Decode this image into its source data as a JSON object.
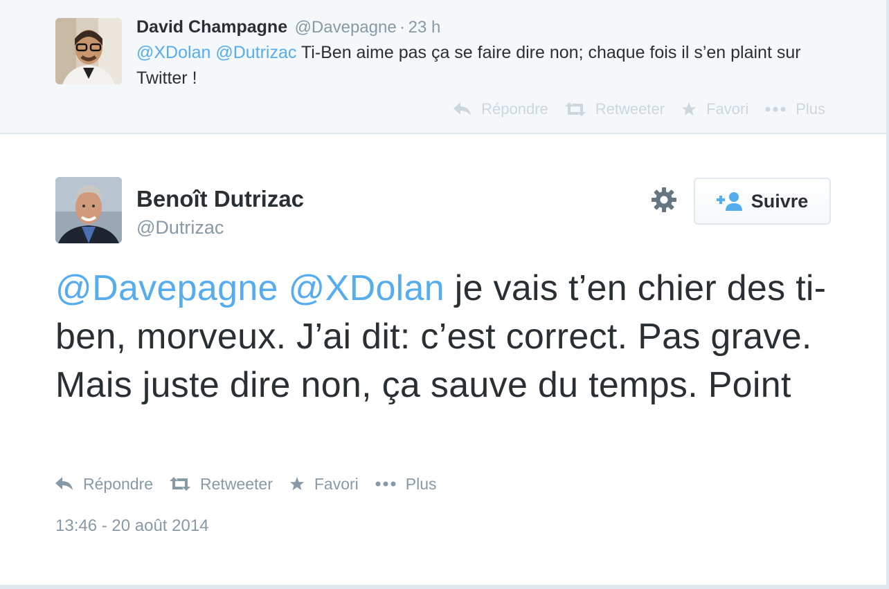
{
  "colors": {
    "accent": "#55acee",
    "text": "#292f33",
    "muted": "#8899a6",
    "faded": "#ccd6dd",
    "context_bg": "#f5f8fa"
  },
  "parent_tweet": {
    "avatar_icon": "user-photo-avatar",
    "name": "David Champagne",
    "handle": "@Davepagne",
    "separator": "·",
    "time": "23 h",
    "mention_1": "@XDolan",
    "mention_2": "@Dutrizac",
    "text": "Ti-Ben aime pas ça se faire dire non; chaque fois il s’en plaint sur Twitter !",
    "actions": {
      "reply": "Répondre",
      "retweet": "Retweeter",
      "favorite": "Favori",
      "more": "Plus"
    }
  },
  "main_tweet": {
    "avatar_icon": "user-photo-avatar",
    "name": "Benoît Dutrizac",
    "handle": "@Dutrizac",
    "settings_icon": "gear-icon",
    "follow_label": "Suivre",
    "follow_icon": "add-user-icon",
    "mention_1": "@Davepagne",
    "mention_2": "@XDolan",
    "text": "je vais t’en chier des ti-ben, morveux. J’ai dit: c’est correct. Pas grave. Mais juste dire non, ça sauve du temps. Point",
    "actions": {
      "reply": "Répondre",
      "retweet": "Retweeter",
      "favorite": "Favori",
      "more": "Plus"
    },
    "timestamp": "13:46 - 20 août 2014"
  }
}
